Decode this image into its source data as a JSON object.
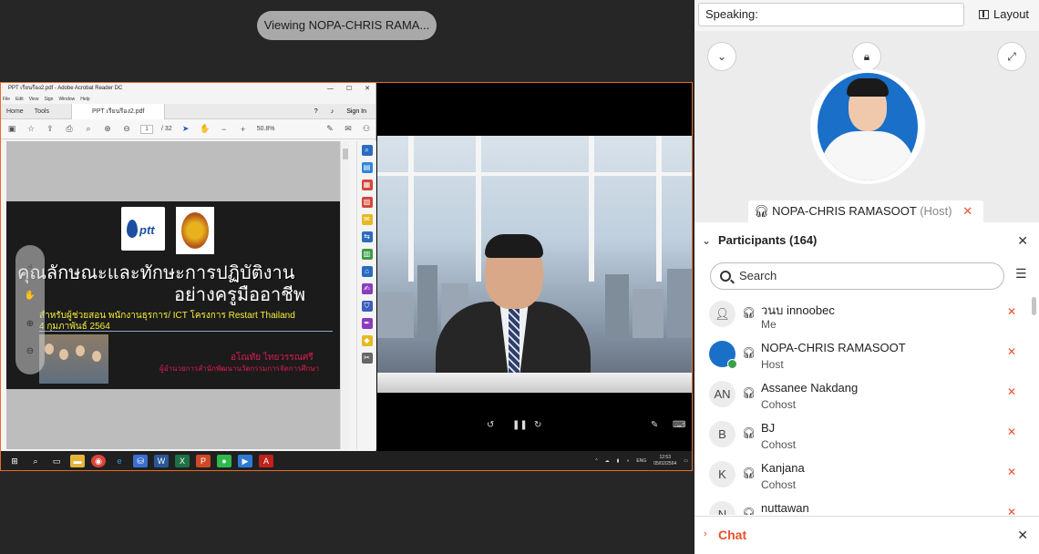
{
  "viewing_banner": "Viewing NOPA-CHRIS RAMA...",
  "acrobat": {
    "title": "PPT เรียนรีอง2.pdf - Adobe Acrobat Reader DC",
    "menu": [
      "File",
      "Edit",
      "View",
      "Sign",
      "Window",
      "Help"
    ],
    "tabs": {
      "home": "Home",
      "tools": "Tools",
      "doc": "PPT เรียนรีอง2.pdf"
    },
    "sign_in": "Sign In",
    "page_current": "1",
    "page_total": "/ 32",
    "zoom": "50.8%"
  },
  "slide": {
    "logo_text": "ptt",
    "title_line1": "คุณลักษณะและทักษะการปฏิบัติงาน",
    "title_line2": "อย่างครูมืออาชีพ",
    "subtitle_line1": "สำหรับผู้ช่วยสอน พนักงานธุรการ/ ICT โครงการ Restart Thailand",
    "subtitle_line2": "4 กุมภาพันธ์ 2564",
    "presenter": "อโณทัย  ไทยวรรณศรี",
    "presenter_role": "ผู้อำนวยการสำนักพัฒนานวัตกรรมการจัดการศึกษา"
  },
  "taskbar": {
    "lang": "ENG",
    "time": "12:53",
    "date": "05/02/2564"
  },
  "panel": {
    "speaking_label": "Speaking:",
    "layout_label": "Layout",
    "speaker_name": "NOPA-CHRIS RAMASOOT",
    "speaker_role": "(Host)",
    "participants_title": "Participants (164)",
    "search_placeholder": "Search",
    "participants": [
      {
        "initials": "",
        "name": "วนบ innoobec",
        "role": "Me"
      },
      {
        "initials": "",
        "name": "NOPA-CHRIS RAMASOOT",
        "role": "Host"
      },
      {
        "initials": "AN",
        "name": "Assanee Nakdang",
        "role": "Cohost"
      },
      {
        "initials": "B",
        "name": "BJ",
        "role": "Cohost"
      },
      {
        "initials": "K",
        "name": "Kanjana",
        "role": "Cohost"
      },
      {
        "initials": "N",
        "name": "nuttawan",
        "role": ""
      }
    ],
    "chat_title": "Chat"
  },
  "colors": {
    "accent": "#e8512a",
    "share_border": "#e86b2a",
    "avatar_blue": "#1a6fc8"
  }
}
